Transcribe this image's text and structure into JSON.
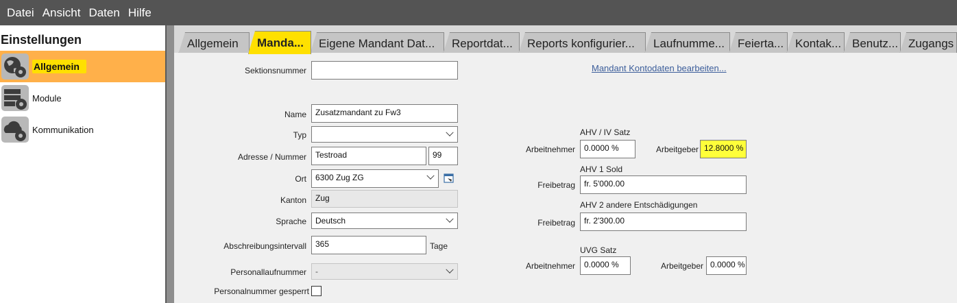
{
  "menu": [
    "Datei",
    "Ansicht",
    "Daten",
    "Hilfe"
  ],
  "sidebar": {
    "title": "Einstellungen",
    "items": [
      {
        "label": "Allgemein",
        "icon": "globe-gear-icon",
        "active": true
      },
      {
        "label": "Module",
        "icon": "server-gear-icon",
        "active": false
      },
      {
        "label": "Kommunikation",
        "icon": "cloud-gear-icon",
        "active": false
      }
    ]
  },
  "tabs": [
    "Allgemein",
    "Manda...",
    "Eigene Mandant Dat...",
    "Reportdat...",
    "Reports konfigurier...",
    "Laufnumme...",
    "Feierta...",
    "Kontak...",
    "Benutz...",
    "Zugangs"
  ],
  "form": {
    "sektionsnummer_label": "Sektionsnummer",
    "sektionsnummer_value": "",
    "name_label": "Name",
    "name_value": "Zusatzmandant zu Fw3",
    "typ_label": "Typ",
    "typ_value": "",
    "adresse_label": "Adresse / Nummer",
    "adresse_value": "Testroad",
    "nummer_value": "99",
    "ort_label": "Ort",
    "ort_value": "6300 Zug ZG",
    "kanton_label": "Kanton",
    "kanton_value": "Zug",
    "sprache_label": "Sprache",
    "sprache_value": "Deutsch",
    "abschreibung_label": "Abschreibungsintervall",
    "abschreibung_value": "365",
    "abschreibung_unit": "Tage",
    "personallauf_label": "Personallaufnummer",
    "personallauf_value": "-",
    "gesperrt_label": "Personalnummer gesperrt"
  },
  "right": {
    "kontodaten_link": "Mandant Kontodaten bearbeiten...",
    "ahv_iv_title": "AHV / IV Satz",
    "arbeitnehmer_label": "Arbeitnehmer",
    "ahv_an_value": "0.0000 %",
    "arbeitgeber_label": "Arbeitgeber",
    "ahv_ag_value": "12.8000 %",
    "ahv1_title": "AHV 1 Sold",
    "freibetrag_label": "Freibetrag",
    "ahv1_freibetrag": "fr. 5'000.00",
    "ahv2_title": "AHV 2 andere Entschädigungen",
    "ahv2_freibetrag": "fr. 2'300.00",
    "uvg_title": "UVG Satz",
    "uvg_an_value": "0.0000 %",
    "uvg_ag_value": "0.0000 %"
  }
}
